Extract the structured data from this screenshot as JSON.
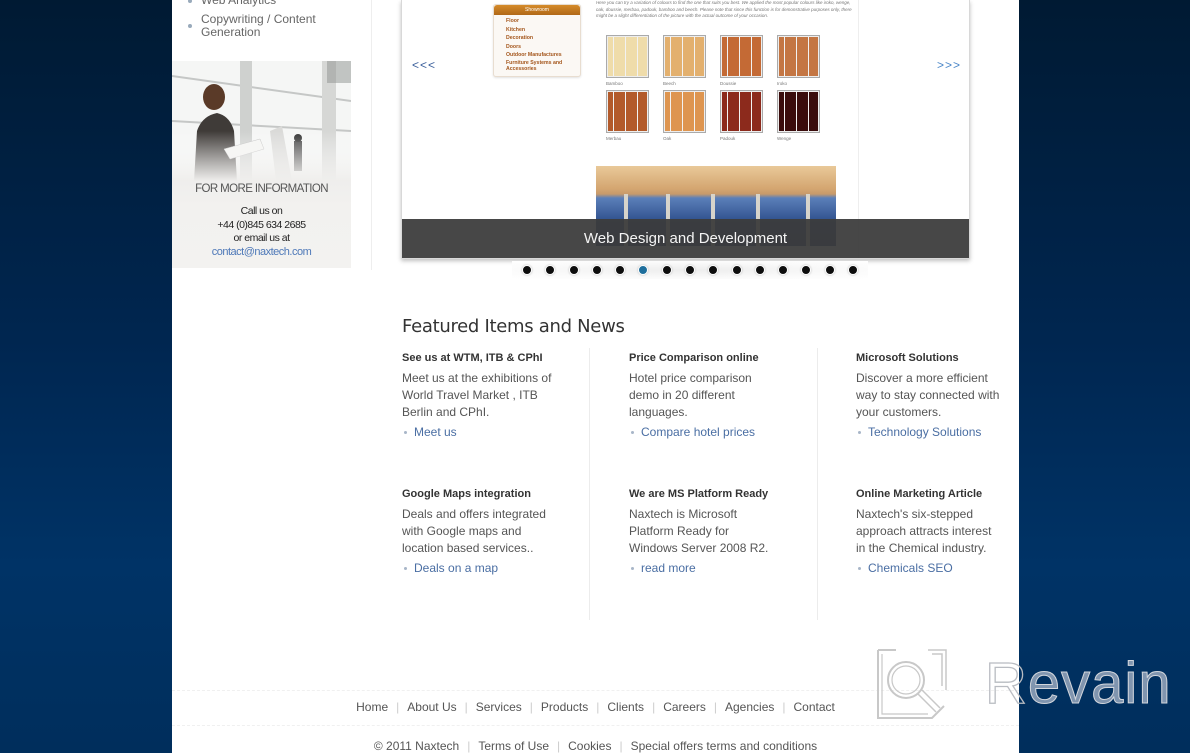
{
  "sidebar": {
    "items": [
      {
        "label": "Web Analytics"
      },
      {
        "label": "Copywriting / Content Generation"
      }
    ],
    "info_box": {
      "title": "FOR MORE INFORMATION",
      "call_label": "Call us on",
      "phone": "+44 (0)845 634 2685",
      "email_label": "or email us at",
      "email": "contact@naxtech.com"
    }
  },
  "slider": {
    "prev_label": "<<<",
    "next_label": ">>>",
    "caption": "Web Design and Development",
    "total_slides": 15,
    "active_slide": 6,
    "showroom": {
      "header": "Showroom",
      "items": [
        "Floor",
        "Kitchen",
        "Decoration",
        "Doors",
        "Outdoor Manufactures",
        "Furniture Systems and Accessories"
      ]
    },
    "intro_text": "Here you can try a variation of colours to find the one that suits you best. We applied the most popular colours like iroko, wenge, oak, doussie, merbau, padouk, bamboo and beech. Please note that since this function is for demonstrative purposes only, there might be a slight differentiation of the picture with the actual outcome of your occasion.",
    "swatches": [
      {
        "name": "Bamboo",
        "color": "#efdcaa"
      },
      {
        "name": "Beech",
        "color": "#e3b06e"
      },
      {
        "name": "Doussie",
        "color": "#c46a35"
      },
      {
        "name": "Iroko",
        "color": "#c47643"
      },
      {
        "name": "Merbau",
        "color": "#b35a2a"
      },
      {
        "name": "Oak",
        "color": "#de9550"
      },
      {
        "name": "Padouk",
        "color": "#8c2a1c"
      },
      {
        "name": "Wenge",
        "color": "#3a0c0c"
      }
    ]
  },
  "featured": {
    "title": "Featured Items and News",
    "items": [
      {
        "title": "See us at WTM, ITB & CPhI",
        "body": "Meet us at the exhibitions of World Travel Market , ITB Berlin and CPhI.",
        "link": "Meet us"
      },
      {
        "title": "Price Comparison online",
        "body": "Hotel price comparison demo in 20 different languages.",
        "link": "Compare hotel prices"
      },
      {
        "title": "Microsoft Solutions",
        "body": "Discover a more efficient way to stay connected with your customers.",
        "link": "Technology Solutions"
      },
      {
        "title": "Google Maps integration",
        "body": "Deals and offers integrated with Google maps and location based services..",
        "link": "Deals on a map"
      },
      {
        "title": "We are MS Platform Ready",
        "body": "Naxtech is Microsoft Platform Ready for Windows Server 2008 R2.",
        "link": "read more"
      },
      {
        "title": "Online Marketing Article",
        "body": "Naxtech's six-stepped approach attracts interest in the Chemical industry.",
        "link": "Chemicals SEO"
      }
    ]
  },
  "footer": {
    "nav": [
      "Home",
      "About Us",
      "Services",
      "Products",
      "Clients",
      "Careers",
      "Agencies",
      "Contact"
    ],
    "legal": [
      "© 2011 Naxtech",
      "Terms of Use",
      "Cookies",
      "Special offers terms and conditions"
    ]
  },
  "watermark": {
    "text": "Revain"
  }
}
